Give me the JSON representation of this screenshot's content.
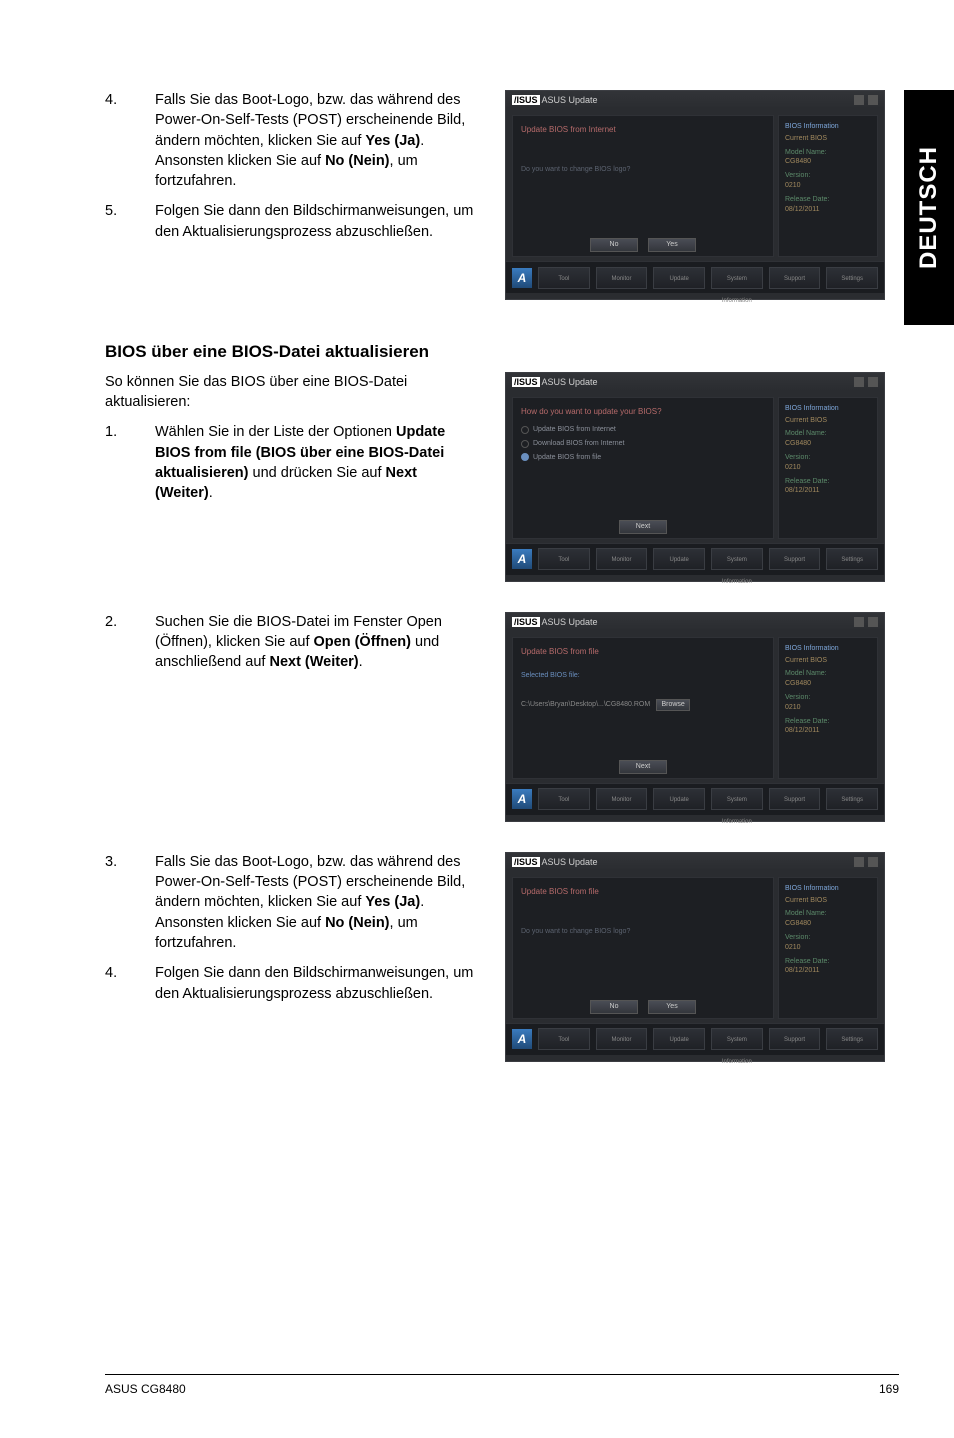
{
  "sideTab": "DEUTSCH",
  "blockA": {
    "steps": [
      {
        "num": "4.",
        "text_pre": "Falls Sie das Boot-Logo, bzw. das während des Power-On-Self-Tests (POST) erscheinende Bild, ändern möchten, klicken Sie auf ",
        "b1": "Yes (Ja)",
        "mid": ". Ansonsten klicken Sie auf ",
        "b2": "No (Nein)",
        "text_post": ", um fortzufahren."
      },
      {
        "num": "5.",
        "text": "Folgen Sie dann den Bildschirmanweisungen, um den Aktualisierungsprozess abzuschließen."
      }
    ]
  },
  "sectionHeading": "BIOS über eine BIOS-Datei aktualisieren",
  "intro": "So können Sie das BIOS über eine BIOS-Datei aktualisieren:",
  "blockB": {
    "num": "1.",
    "pre": "Wählen Sie in der Liste der Optionen ",
    "b1": "Update BIOS from file (BIOS über eine BIOS-Datei aktualisieren)",
    "mid": " und drücken Sie auf ",
    "b2": "Next (Weiter)",
    "post": "."
  },
  "blockC": {
    "num": "2.",
    "pre": "Suchen Sie die BIOS-Datei im Fenster Open (Öffnen), klicken Sie auf ",
    "b1": "Open (Öffnen)",
    "mid": " und anschließend auf ",
    "b2": "Next (Weiter)",
    "post": "."
  },
  "blockD": {
    "steps": [
      {
        "num": "3.",
        "text_pre": "Falls Sie das Boot-Logo, bzw. das während des Power-On-Self-Tests (POST) erscheinende Bild, ändern möchten, klicken Sie auf ",
        "b1": "Yes (Ja)",
        "mid": ". Ansonsten klicken Sie auf ",
        "b2": "No (Nein)",
        "text_post": ", um fortzufahren."
      },
      {
        "num": "4.",
        "text": "Folgen Sie dann den Bildschirmanweisungen, um den Aktualisierungsprozess abzuschließen."
      }
    ]
  },
  "shot": {
    "title": "ASUS Update",
    "infoHeader": "BIOS Information",
    "current": "Current BIOS",
    "model": "Model Name:",
    "modelVal": "CG8480",
    "version": "Version:",
    "versionVal": "0210",
    "date": "Release Date:",
    "dateVal": "08/12/2011",
    "footers": [
      "Tool",
      "Monitor",
      "Update",
      "System Information",
      "Support",
      "Settings"
    ],
    "s1_header": "Update BIOS from Internet",
    "s1_body": "Do you want to change BIOS logo?",
    "s1_nav": [
      "No",
      "Yes"
    ],
    "s2_header": "How do you want to update your BIOS?",
    "s2_opt1": "Update BIOS from Internet",
    "s2_opt2": "Download BIOS from Internet",
    "s2_opt3": "Update BIOS from file",
    "s2_nav": "Next",
    "s3_header": "Update BIOS from file",
    "s3_label": "Selected BIOS file:",
    "s3_file": "C:\\Users\\Bryan\\Desktop\\...\\CG8480.ROM",
    "s3_browse": "Browse",
    "s3_nav": "Next",
    "s4_header": "Update BIOS from file",
    "s4_body": "Do you want to change BIOS logo?",
    "s4_nav": [
      "No",
      "Yes"
    ]
  },
  "footer": {
    "left": "ASUS CG8480",
    "right": "169"
  }
}
